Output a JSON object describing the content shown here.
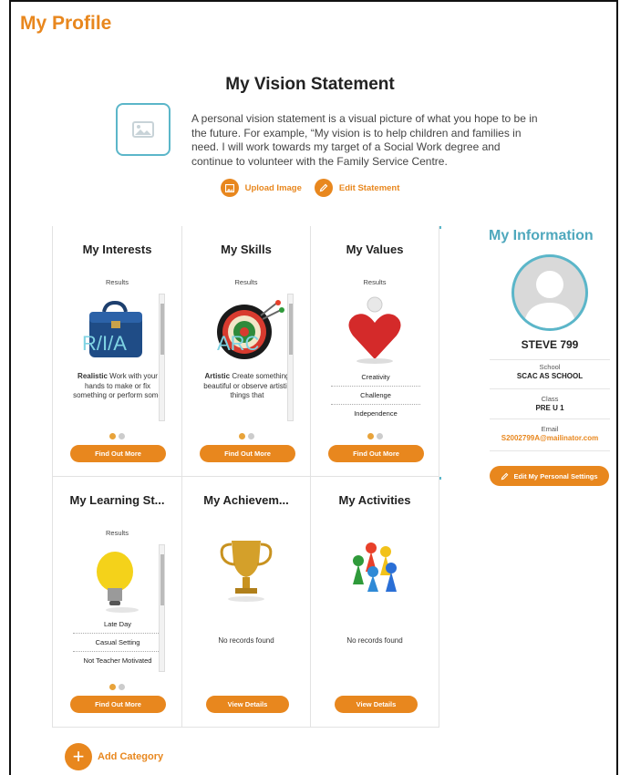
{
  "page": {
    "title": "My Profile"
  },
  "vision": {
    "title": "My Vision Statement",
    "text": "A personal vision statement is a visual picture of what you hope to be in the future. For example, “My vision is to help children and families in need. I will work towards my target of a Social Work degree and continue to volunteer with the Family Service Centre.",
    "upload_label": "Upload Image",
    "edit_label": "Edit Statement"
  },
  "cards": {
    "interests": {
      "title": "My Interests",
      "sub": "Results",
      "code": "R/I/A",
      "desc_bold": "Realistic",
      "desc": " Work with your hands to make or fix something or perform some",
      "button": "Find Out More"
    },
    "skills": {
      "title": "My Skills",
      "sub": "Results",
      "code": "ARC",
      "desc_bold": "Artistic",
      "desc": " Create something beautiful or observe artistic things that",
      "button": "Find Out More"
    },
    "values": {
      "title": "My Values",
      "sub": "Results",
      "items": [
        "Creativity",
        "Challenge",
        "Independence"
      ],
      "button": "Find Out More"
    },
    "learning": {
      "title": "My Learning St...",
      "sub": "Results",
      "items": [
        "Late Day",
        "Casual Setting",
        "Not Teacher Motivated"
      ],
      "button": "Find Out More"
    },
    "achievements": {
      "title": "My Achievem...",
      "empty": "No records found",
      "button": "View Details"
    },
    "activities": {
      "title": "My Activities",
      "empty": "No records found",
      "button": "View Details"
    }
  },
  "info": {
    "title": "My Information",
    "name": "STEVE 799",
    "school_label": "School",
    "school": "SCAC AS SCHOOL",
    "class_label": "Class",
    "class": "PRE U 1",
    "email_label": "Email",
    "email": "S2002799A@mailinator.com",
    "settings_button": "Edit My Personal Settings"
  },
  "add_category": "Add Category",
  "colors": {
    "accent": "#e8871e",
    "teal": "#5bb6c9"
  }
}
